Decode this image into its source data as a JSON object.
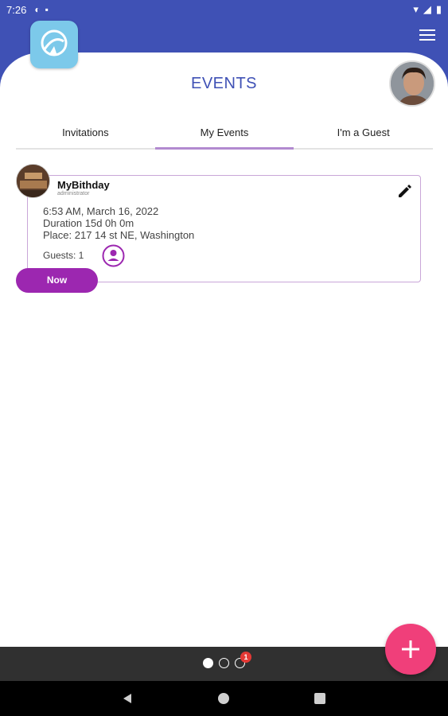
{
  "status_bar": {
    "time": "7:26"
  },
  "app": {
    "title": "EVENTS"
  },
  "tabs": [
    {
      "label": "Invitations"
    },
    {
      "label": "My Events"
    },
    {
      "label": "I'm a Guest"
    }
  ],
  "event": {
    "name": "MyBithday",
    "role": "administrator",
    "datetime": "6:53 AM, March 16, 2022",
    "duration": "Duration 15d 0h 0m",
    "place": "Place: 217 14 st NE, Washington",
    "guests": "Guests: 1",
    "status_button": "Now"
  },
  "pager": {
    "badge": "1"
  },
  "colors": {
    "primary": "#3f51b5",
    "accent": "#9c27b0",
    "fab": "#f03f7a",
    "logo": "#7cc9ea"
  }
}
